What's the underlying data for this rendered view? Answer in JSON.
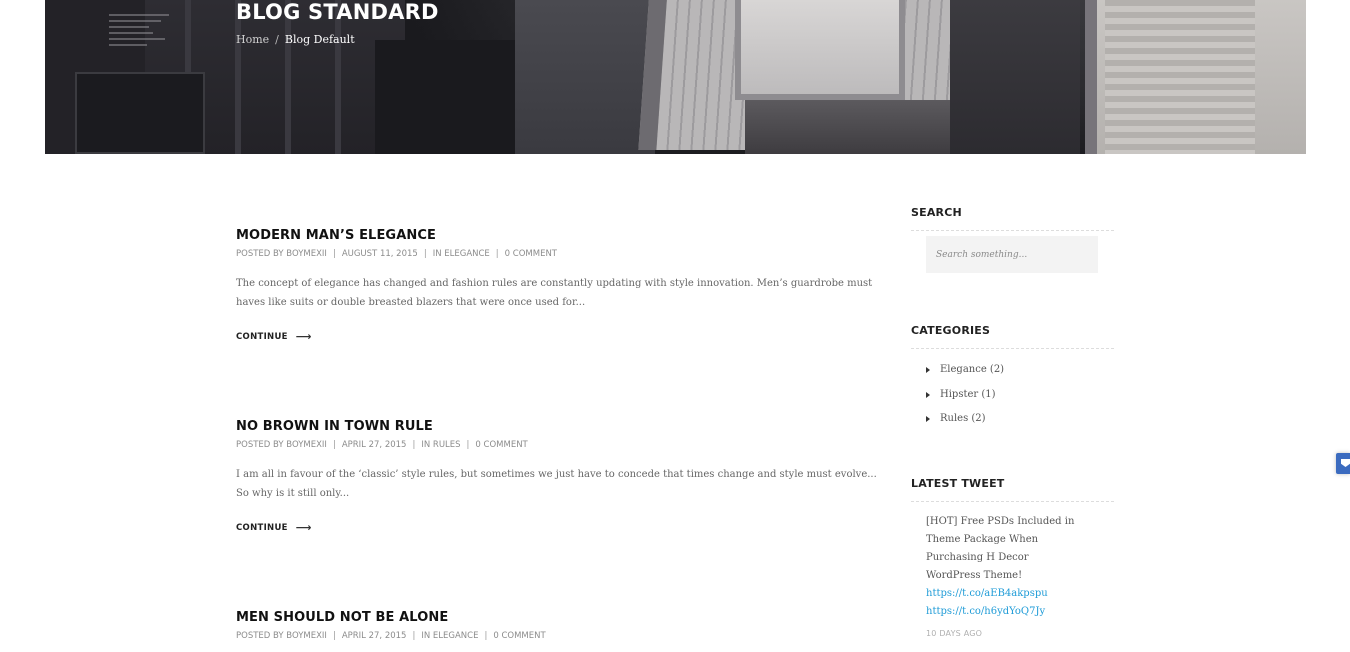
{
  "hero": {
    "title": "BLOG STANDARD",
    "breadcrumb": {
      "home": "Home",
      "separator": "/",
      "current": "Blog Default"
    }
  },
  "posts": [
    {
      "title": "MODERN MAN’S ELEGANCE",
      "posted_by": "POSTED BY BOYMEXII",
      "date": "AUGUST 11, 2015",
      "category": "IN ELEGANCE",
      "comments": "0 COMMENT",
      "excerpt": "The concept of elegance has changed and fashion rules are constantly updating with style innovation. Men’s guardrobe must haves like suits or double breasted blazers that were once used for...",
      "continue_label": "CONTINUE"
    },
    {
      "title": "NO BROWN IN TOWN RULE",
      "posted_by": "POSTED BY BOYMEXII",
      "date": "APRIL 27, 2015",
      "category": "IN RULES",
      "comments": "0 COMMENT",
      "excerpt": "I am all in favour of the ‘classic’ style rules, but sometimes we just have to concede that times change and style must evolve... So why is it still only...",
      "continue_label": "CONTINUE"
    },
    {
      "title": "MEN SHOULD NOT BE ALONE",
      "posted_by": "POSTED BY BOYMEXII",
      "date": "APRIL 27, 2015",
      "category": "IN ELEGANCE",
      "comments": "0 COMMENT"
    }
  ],
  "meta_separator": "|",
  "sidebar": {
    "search": {
      "title": "SEARCH",
      "placeholder": "Search something..."
    },
    "categories": {
      "title": "CATEGORIES",
      "items": [
        {
          "label": "Elegance (2)"
        },
        {
          "label": "Hipster (1)"
        },
        {
          "label": "Rules (2)"
        }
      ]
    },
    "latest_tweet": {
      "title": "LATEST TWEET",
      "text": "[HOT] Free PSDs Included in Theme Package When Purchasing H Decor WordPress Theme!",
      "links": [
        "https://t.co/aEB4akpspu",
        "https://t.co/h6ydYoQ7Jy"
      ],
      "time": "10 DAYS AGO"
    }
  },
  "colors": {
    "link": "#1e9bd7",
    "heading": "#111111",
    "edge_tab": "#3b6bbf"
  },
  "icons": {
    "continue_arrow": "long-arrow-right-icon",
    "category_bullet": "caret-right-icon",
    "edge_tab": "bookmark-icon"
  }
}
